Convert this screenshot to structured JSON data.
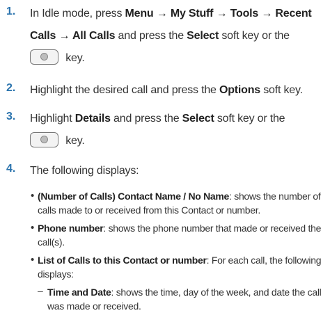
{
  "step1": {
    "number": "1.",
    "t1": "In Idle mode, press ",
    "menu": "Menu",
    "a1": " → ",
    "mystuff": "My Stuff",
    "a2": " → ",
    "tools": "Tools",
    "a3": " → ",
    "recent": "Recent Calls",
    "a4": " → ",
    "allcalls": "All Calls",
    "t2": " and press the ",
    "select": "Select",
    "t3": " soft key or the",
    "t4": " key."
  },
  "step2": {
    "number": "2.",
    "t1": "Highlight the desired call and press the ",
    "options": "Options",
    "t2": " soft key."
  },
  "step3": {
    "number": "3.",
    "t1": "Highlight ",
    "details": "Details",
    "t2": " and press the ",
    "select": "Select",
    "t3": " soft key or the",
    "t4": " key."
  },
  "step4": {
    "number": "4.",
    "text": "The following displays:"
  },
  "bullets": [
    {
      "bold": "(Number of Calls) Contact Name / No Name",
      "text": ": shows the number of calls made to or received from this Contact or number."
    },
    {
      "bold": "Phone number",
      "text": ": shows the phone number that made or received the call(s)."
    },
    {
      "bold": "List of Calls to this Contact or number",
      "text": ": For each call, the following displays:"
    }
  ],
  "subbullet": {
    "bold": "Time and Date",
    "text": ": shows the time, day of the week, and date the call was made or received."
  },
  "colors": {
    "step_number": "#2a73ad"
  }
}
